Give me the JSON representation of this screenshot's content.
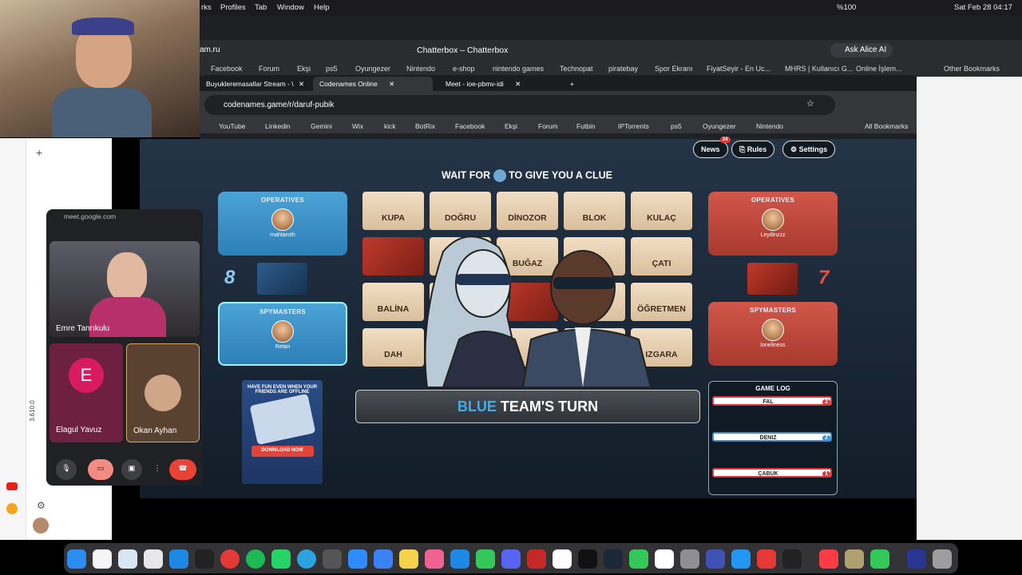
{
  "menubar": {
    "items": [
      "rks",
      "Profiles",
      "Tab",
      "Window",
      "Help"
    ],
    "battery": "%100",
    "datetime": "Sat Feb 28  04:17"
  },
  "browser1": {
    "url_partial": "am.ru",
    "title": "Chatterbox – Chatterbox",
    "ask_ai": "Ask Alice AI",
    "bookmarks": [
      "Facebook",
      "Forum",
      "Ekşi",
      "ps5",
      "Oyungezer",
      "Nintendo",
      "e-shop",
      "nintendo games",
      "Technopat",
      "piratebay",
      "Spor Ekranı",
      "FiyatSeyir - En Uc...",
      "MHRS | Kullanıcı G...",
      "Online İşlem..."
    ],
    "other_bookmarks": "Other Bookmarks"
  },
  "win2": {
    "tabs": [
      "Buyukleremasallar Stream - \\",
      "Codenames Online",
      "Meet - ioe-pbmv-idi"
    ],
    "url": "codenames.game/r/daruf-pubik",
    "bookmarks": [
      "YouTube",
      "Linkedin",
      "Gemini",
      "Wix",
      "kick",
      "BotRix",
      "Facebook",
      "Ekşi",
      "Forum",
      "Futbin",
      "IPTorrents",
      "ps5",
      "Oyungezer",
      "Nintendo"
    ],
    "all_bookmarks": "All Bookmarks"
  },
  "game": {
    "news": "News",
    "news_badge": "24",
    "rules": "Rules",
    "settings": "Settings",
    "clue_left": "WAIT FOR",
    "clue_right": "TO GIVE YOU A CLUE",
    "blue": {
      "operatives_label": "OPERATIVES",
      "operative": "mahtaroth",
      "count": "8",
      "spymasters_label": "SPYMASTERS",
      "spymaster": "Retan"
    },
    "red": {
      "operatives_label": "OPERATIVES",
      "operative": "Leydinzzz",
      "count": "7",
      "spymasters_label": "SPYMASTERS",
      "spymaster": "loneliness"
    },
    "cards": [
      "KUPA",
      "DOĞRU",
      "DİNOZOR",
      "BLOK",
      "KULAÇ",
      "",
      "",
      "BUĞAZ",
      "",
      "ÇATI",
      "BALİNA",
      "",
      "",
      "",
      "ÖĞRETMEN",
      "DAH",
      "",
      "",
      "",
      "IZGARA"
    ],
    "turn_team": "BLUE",
    "turn_rest": " TEAM'S TURN",
    "gamelog_title": "GAME LOG",
    "log": [
      {
        "word": "FAL",
        "n": "2",
        "color": "#d63a3a"
      },
      {
        "word": "DENIZ",
        "n": "2",
        "color": "#3b8fd0"
      },
      {
        "word": "ÇABUK",
        "n": "1",
        "color": "#d63a3a"
      }
    ],
    "ad": {
      "headline": "HAVE FUN EVEN WHEN YOUR FRIENDS ARE OFFLINE",
      "cta": "DOWNLOAD NOW"
    }
  },
  "meet": {
    "url": "meet.google.com",
    "p1": "Emre Tanrıkulu",
    "p2": "Elagul Yavuz",
    "p2_initial": "E",
    "p3": "Okan Ayhan"
  },
  "sidebar": {
    "version": "3.610.0"
  }
}
